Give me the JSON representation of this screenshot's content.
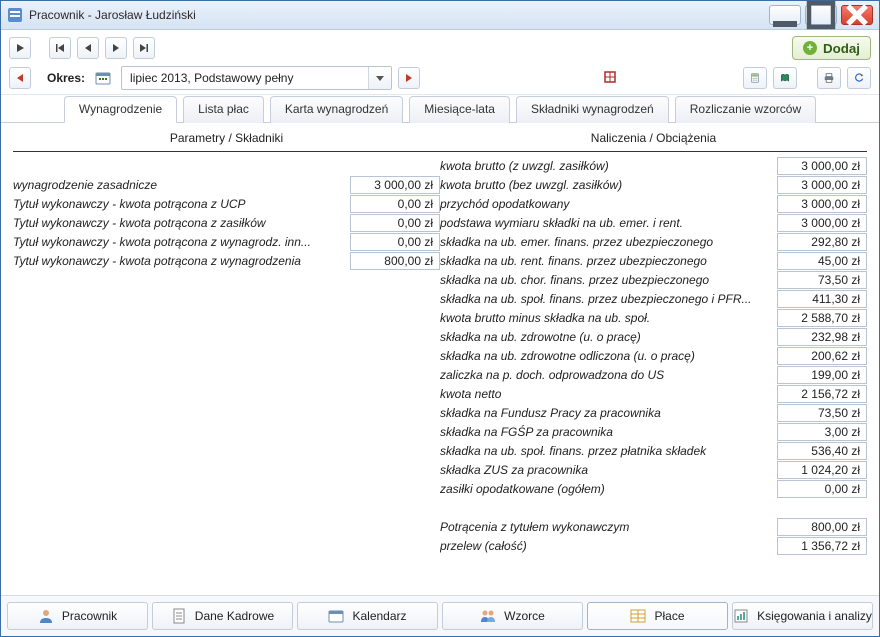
{
  "window": {
    "title": "Pracownik - Jarosław Łudziński"
  },
  "toolbar": {
    "add_label": "Dodaj",
    "period_label": "Okres:",
    "period_value": "lipiec 2013, Podstawowy pełny"
  },
  "tabs": {
    "t0": "Wynagrodzenie",
    "t1": "Lista płac",
    "t2": "Karta wynagrodzeń",
    "t3": "Miesiące-lata",
    "t4": "Składniki wynagrodzeń",
    "t5": "Rozliczanie wzorców"
  },
  "headers": {
    "left": "Parametry / Składniki",
    "right": "Naliczenia / Obciążenia"
  },
  "left_rows": [
    {
      "label": "wynagrodzenie zasadnicze",
      "value": "3 000,00 zł"
    },
    {
      "label": "Tytuł wykonawczy - kwota potrącona z UCP",
      "value": "0,00 zł"
    },
    {
      "label": "Tytuł wykonawczy - kwota potrącona z zasiłków",
      "value": "0,00 zł"
    },
    {
      "label": "Tytuł wykonawczy - kwota potrącona z wynagrodz. inn...",
      "value": "0,00 zł"
    },
    {
      "label": "Tytuł wykonawczy - kwota potrącona z wynagrodzenia",
      "value": "800,00 zł"
    }
  ],
  "right_rows": [
    {
      "label": "kwota brutto (z uwzgl. zasiłków)",
      "value": "3 000,00 zł"
    },
    {
      "label": "kwota brutto (bez uwzgl. zasiłków)",
      "value": "3 000,00 zł"
    },
    {
      "label": "przychód opodatkowany",
      "value": "3 000,00 zł"
    },
    {
      "label": "podstawa wymiaru składki na ub. emer. i rent.",
      "value": "3 000,00 zł"
    },
    {
      "label": "składka na ub. emer. finans. przez ubezpieczonego",
      "value": "292,80 zł"
    },
    {
      "label": "składka na ub. rent. finans. przez ubezpieczonego",
      "value": "45,00 zł"
    },
    {
      "label": "składka na ub. chor. finans. przez ubezpieczonego",
      "value": "73,50 zł"
    },
    {
      "label": "składka na ub. społ. finans. przez ubezpieczonego i PFR...",
      "value": "411,30 zł"
    },
    {
      "label": "kwota brutto minus składka na ub. społ.",
      "value": "2 588,70 zł"
    },
    {
      "label": "składka na ub. zdrowotne (u. o pracę)",
      "value": "232,98 zł"
    },
    {
      "label": "składka na ub. zdrowotne odliczona (u. o pracę)",
      "value": "200,62 zł"
    },
    {
      "label": "zaliczka na p. doch. odprowadzona do US",
      "value": "199,00 zł"
    },
    {
      "label": "kwota netto",
      "value": "2 156,72 zł"
    },
    {
      "label": "składka na Fundusz Pracy za pracownika",
      "value": "73,50 zł"
    },
    {
      "label": "składka na FGŚP za pracownika",
      "value": "3,00 zł"
    },
    {
      "label": "składka na ub. społ. finans. przez płatnika składek",
      "value": "536,40 zł"
    },
    {
      "label": "składka ZUS za pracownika",
      "value": "1 024,20 zł"
    },
    {
      "label": "zasiłki opodatkowane (ogółem)",
      "value": "0,00 zł"
    }
  ],
  "right_summary": [
    {
      "label": "Potrącenia z tytułem wykonawczym",
      "value": "800,00 zł"
    },
    {
      "label": "przelew (całość)",
      "value": "1 356,72 zł"
    }
  ],
  "bottom": {
    "b0": "Pracownik",
    "b1": "Dane Kadrowe",
    "b2": "Kalendarz",
    "b3": "Wzorce",
    "b4": "Płace",
    "b5": "Księgowania i analizy"
  }
}
